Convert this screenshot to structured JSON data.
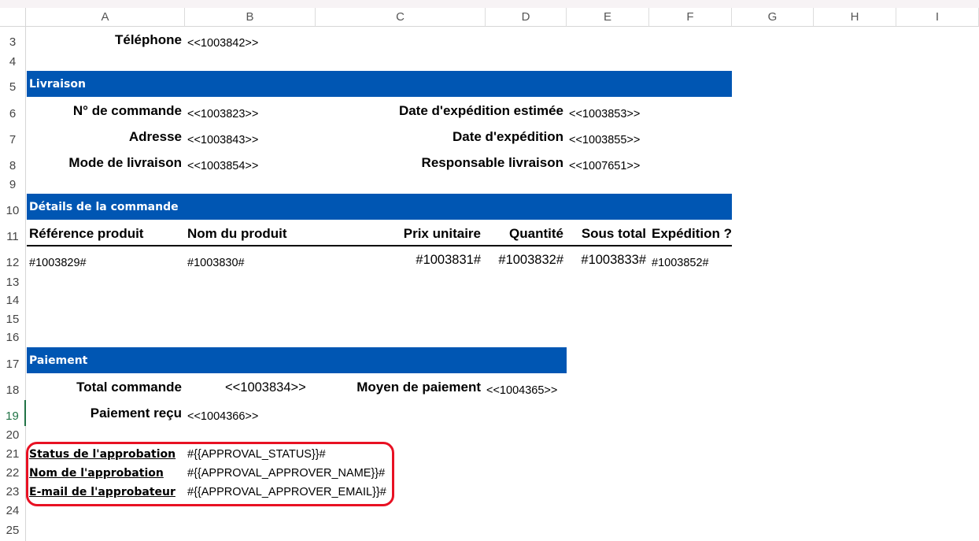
{
  "columns": [
    "A",
    "B",
    "C",
    "D",
    "E",
    "F",
    "G",
    "H",
    "I"
  ],
  "rows": [
    "3",
    "4",
    "5",
    "6",
    "7",
    "8",
    "9",
    "10",
    "11",
    "12",
    "13",
    "14",
    "15",
    "16",
    "17",
    "18",
    "19",
    "20",
    "21",
    "22",
    "23",
    "24",
    "25"
  ],
  "contact": {
    "phone_label": "Téléphone",
    "phone_value": "<<1003842>>"
  },
  "delivery": {
    "header": "Livraison",
    "order_no_label": "N° de commande",
    "order_no_value": "<<1003823>>",
    "address_label": "Adresse",
    "address_value": "<<1003843>>",
    "mode_label": "Mode de livraison",
    "mode_value": "<<1003854>>",
    "est_date_label": "Date d'expédition estimée",
    "est_date_value": "<<1003853>>",
    "ship_date_label": "Date d'expédition",
    "ship_date_value": "<<1003855>>",
    "resp_label": "Responsable livraison",
    "resp_value": "<<1007651>>"
  },
  "order_details": {
    "header": "Détails de la commande",
    "columns": [
      "Référence produit",
      "Nom du produit",
      "Prix unitaire",
      "Quantité",
      "Sous total",
      "Expédition ?"
    ],
    "row": [
      "#1003829#",
      "#1003830#",
      "#1003831#",
      "#1003832#",
      "#1003833#",
      "#1003852#"
    ]
  },
  "payment": {
    "header": "Paiement",
    "total_label": "Total commande",
    "total_value": "<<1003834>>",
    "method_label": "Moyen de paiement",
    "method_value": "<<1004365>>",
    "received_label": "Paiement reçu",
    "received_value": "<<1004366>>"
  },
  "approval": {
    "status_label": "Status de l'approbation",
    "status_value": "#{{APPROVAL_STATUS}}#",
    "name_label": "Nom de l'approbation",
    "name_value": "#{{APPROVAL_APPROVER_NAME}}#",
    "email_label": "E-mail de l'approbateur",
    "email_value": "#{{APPROVAL_APPROVER_EMAIL}}#"
  },
  "colors": {
    "band": "#0056b3",
    "highlight_box": "#e81123",
    "selected_row": "#217346"
  }
}
